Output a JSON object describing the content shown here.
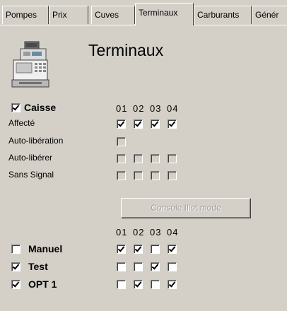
{
  "tabs": [
    {
      "label": "Pompes",
      "active": false
    },
    {
      "label": "Prix",
      "active": false
    },
    {
      "label": "Cuves",
      "active": false
    },
    {
      "label": "Terminaux",
      "active": true
    },
    {
      "label": "Carburants",
      "active": false
    },
    {
      "label": "Génér",
      "active": false
    }
  ],
  "title": "Terminaux",
  "icon": "cash-register-icon",
  "caisse": {
    "label": "Caisse",
    "checked": true,
    "headers": [
      "01",
      "02",
      "03",
      "04"
    ],
    "rows": [
      {
        "label": "Affecté",
        "values": [
          true,
          true,
          true,
          true
        ],
        "enabled": true
      },
      {
        "label": "Auto-libération",
        "values": [
          false
        ],
        "enabled": false
      },
      {
        "label": "Auto-libérer",
        "values": [
          false,
          false,
          false,
          false
        ],
        "enabled": false
      },
      {
        "label": "Sans Signal",
        "values": [
          false,
          false,
          false,
          false
        ],
        "enabled": false
      }
    ]
  },
  "console_button": {
    "label": "Console Illot mode",
    "enabled": false
  },
  "terminals": {
    "headers": [
      "01",
      "02",
      "03",
      "04"
    ],
    "rows": [
      {
        "label": "Manuel",
        "checked": false,
        "values": [
          true,
          true,
          false,
          true
        ]
      },
      {
        "label": "Test",
        "checked": true,
        "values": [
          false,
          false,
          true,
          false
        ]
      },
      {
        "label": "OPT 1",
        "checked": true,
        "values": [
          false,
          true,
          false,
          true
        ]
      }
    ]
  }
}
